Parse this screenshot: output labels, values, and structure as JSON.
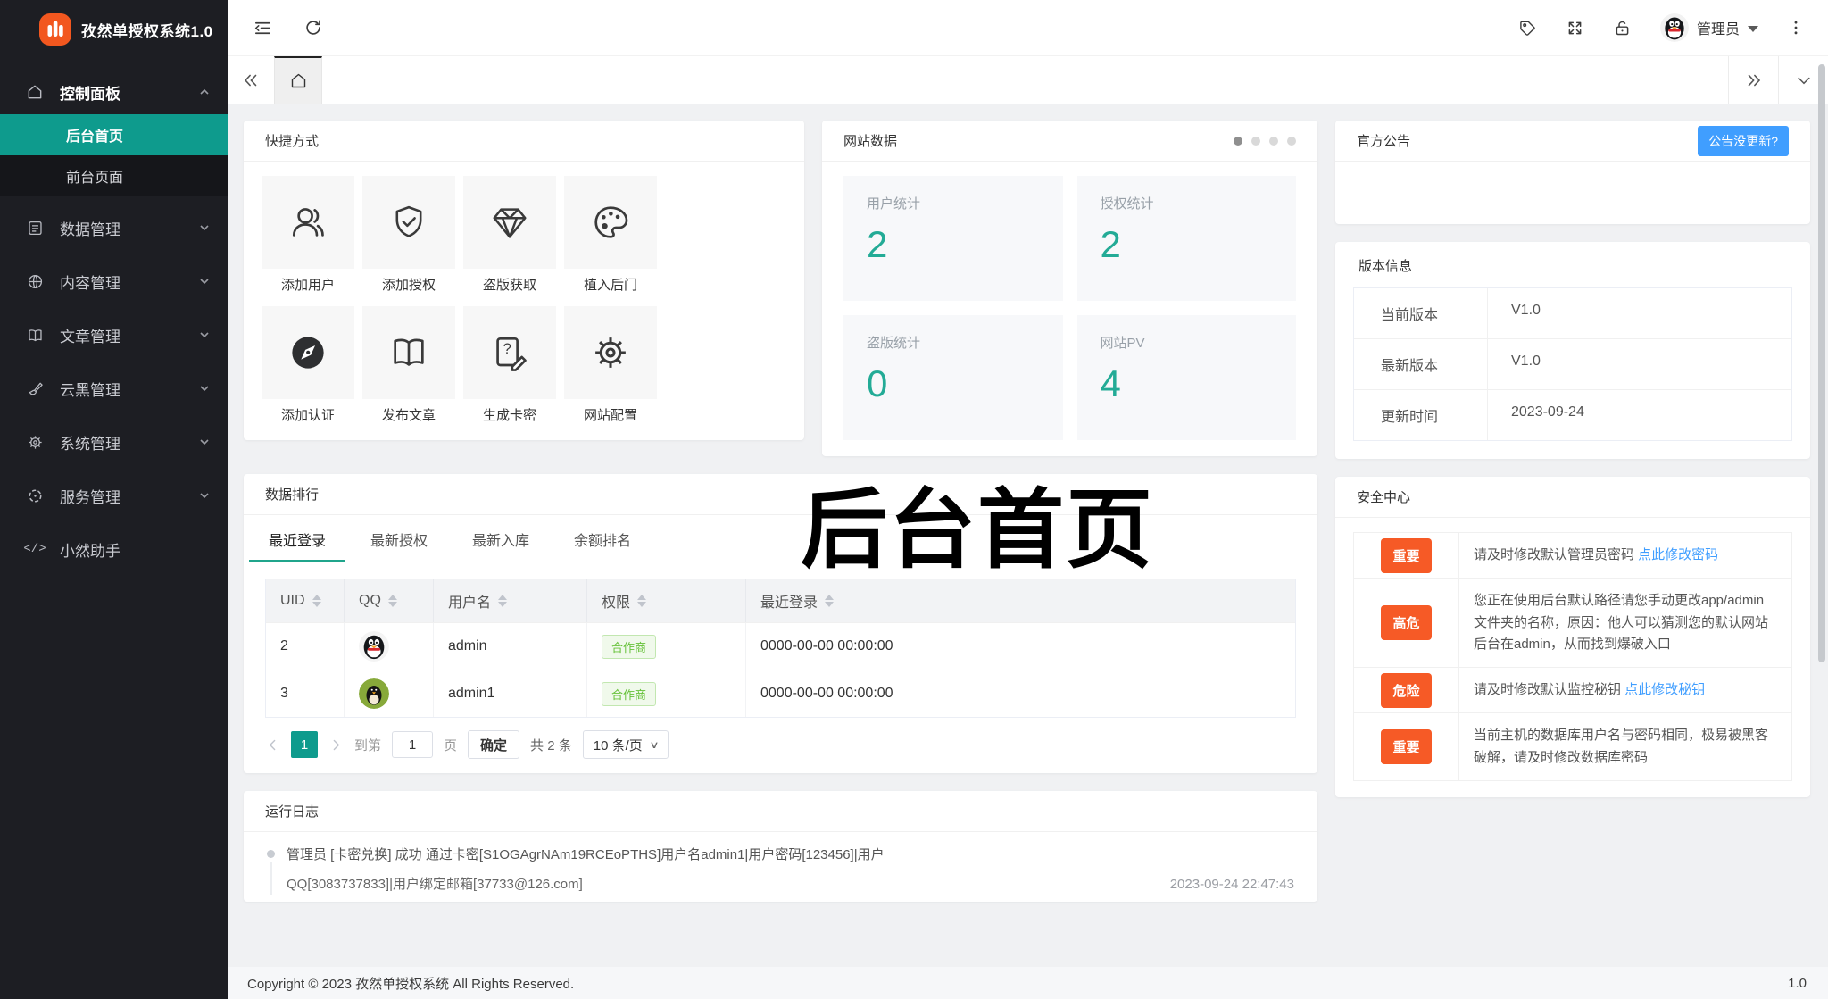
{
  "app": {
    "name": "孜然单授权系统1.0",
    "copyright": "Copyright © 2023 孜然单授权系统 All Rights Reserved.",
    "footer_version": "1.0"
  },
  "header": {
    "username": "管理员"
  },
  "sidebar": {
    "items": [
      {
        "label": "控制面板",
        "children": [
          {
            "label": "后台首页"
          },
          {
            "label": "前台页面"
          }
        ]
      },
      {
        "label": "数据管理"
      },
      {
        "label": "内容管理"
      },
      {
        "label": "文章管理"
      },
      {
        "label": "云黑管理"
      },
      {
        "label": "系统管理"
      },
      {
        "label": "服务管理"
      },
      {
        "label": "小然助手"
      }
    ]
  },
  "shortcuts": {
    "title": "快捷方式",
    "items": [
      {
        "label": "添加用户"
      },
      {
        "label": "添加授权"
      },
      {
        "label": "盗版获取"
      },
      {
        "label": "植入后门"
      },
      {
        "label": "添加认证"
      },
      {
        "label": "发布文章"
      },
      {
        "label": "生成卡密"
      },
      {
        "label": "网站配置"
      }
    ]
  },
  "site_data": {
    "title": "网站数据",
    "stats": [
      {
        "label": "用户统计",
        "value": "2"
      },
      {
        "label": "授权统计",
        "value": "2"
      },
      {
        "label": "盗版统计",
        "value": "0"
      },
      {
        "label": "网站PV",
        "value": "4"
      }
    ]
  },
  "announcement": {
    "title": "官方公告",
    "button_label": "公告没更新?"
  },
  "version_info": {
    "title": "版本信息",
    "rows": [
      {
        "label": "当前版本",
        "value": "V1.0"
      },
      {
        "label": "最新版本",
        "value": "V1.0"
      },
      {
        "label": "更新时间",
        "value": "2023-09-24"
      }
    ]
  },
  "ranking": {
    "title": "数据排行",
    "tabs": [
      {
        "label": "最近登录"
      },
      {
        "label": "最新授权"
      },
      {
        "label": "最新入库"
      },
      {
        "label": "余额排名"
      }
    ],
    "columns": [
      {
        "label": "UID"
      },
      {
        "label": "QQ"
      },
      {
        "label": "用户名"
      },
      {
        "label": "权限"
      },
      {
        "label": "最近登录"
      }
    ],
    "rows": [
      {
        "uid": "2",
        "username": "admin",
        "role": "合作商",
        "last_login": "0000-00-00 00:00:00"
      },
      {
        "uid": "3",
        "username": "admin1",
        "role": "合作商",
        "last_login": "0000-00-00 00:00:00"
      }
    ],
    "pagination": {
      "page": "1",
      "goto_label": "到第",
      "goto_value": "1",
      "page_label": "页",
      "confirm_label": "确定",
      "total_label": "共 2 条",
      "page_size": "10 条/页"
    }
  },
  "security": {
    "title": "安全中心",
    "items": [
      {
        "badge": "重要",
        "text": "请及时修改默认管理员密码 ",
        "link": "点此修改密码"
      },
      {
        "badge": "高危",
        "text": "您正在使用后台默认路径请您手动更改app/admin文件夹的名称，原因：他人可以猜测您的默认网站后台在admin，从而找到爆破入口",
        "link": ""
      },
      {
        "badge": "危险",
        "text": "请及时修改默认监控秘钥 ",
        "link": "点此修改秘钥"
      },
      {
        "badge": "重要",
        "text": "当前主机的数据库用户名与密码相同，极易被黑客破解，请及时修改数据库密码",
        "link": ""
      }
    ]
  },
  "logs": {
    "title": "运行日志",
    "entry": "管理员 [卡密兑换] 成功 通过卡密[S1OGAgrNAm19RCEoPTHS]用户名admin1|用户密码[123456]|用户",
    "entry_more": "QQ[3083737833]|用户绑定邮箱[37733@126.com]",
    "entry_time": "2023-09-24 22:47:43"
  },
  "watermark": "后台首页",
  "colors": {
    "accent_teal": "#0e9b8d",
    "stat_green": "#23ab96",
    "link_blue": "#409eff",
    "warn_orange": "#f65a26",
    "brand_orange": "#f2571f"
  }
}
